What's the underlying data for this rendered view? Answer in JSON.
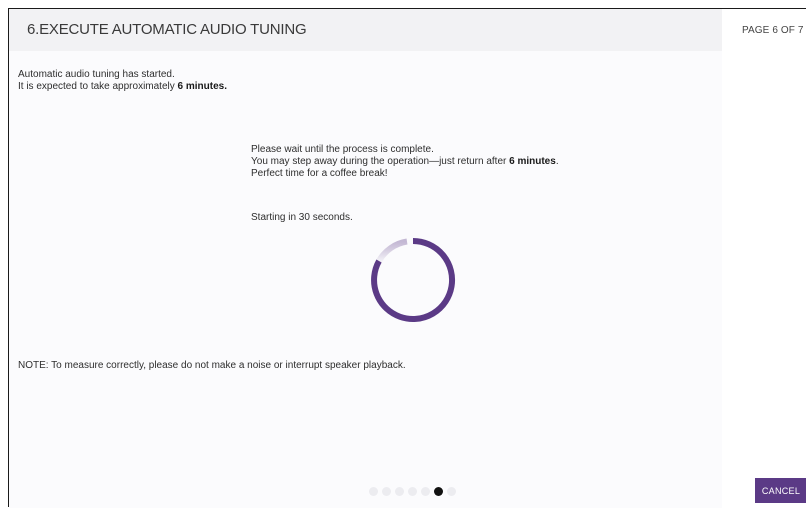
{
  "header": {
    "title": "6.EXECUTE AUTOMATIC AUDIO TUNING",
    "page_indicator": "PAGE 6 OF 7"
  },
  "intro": {
    "line1": "Automatic audio tuning has started.",
    "line2_prefix": "It is expected to take approximately ",
    "line2_bold": "6 minutes."
  },
  "message": {
    "line1": "Please wait until the process is complete.",
    "line2_prefix": "You may step away during the operation—just return after ",
    "line2_bold": "6 minutes",
    "line2_suffix": ".",
    "line3": "Perfect time for a coffee break!"
  },
  "countdown": "Starting in 30 seconds.",
  "spinner_icon": "progress-spinner-icon",
  "note": "NOTE: To measure correctly, please do not make a noise or interrupt speaker playback.",
  "pagination": {
    "total": 7,
    "current": 6
  },
  "cancel_label": "CANCEL",
  "colors": {
    "accent": "#5b3a86",
    "header_bg": "#f2f2f4",
    "content_bg": "#fbfbfd"
  }
}
